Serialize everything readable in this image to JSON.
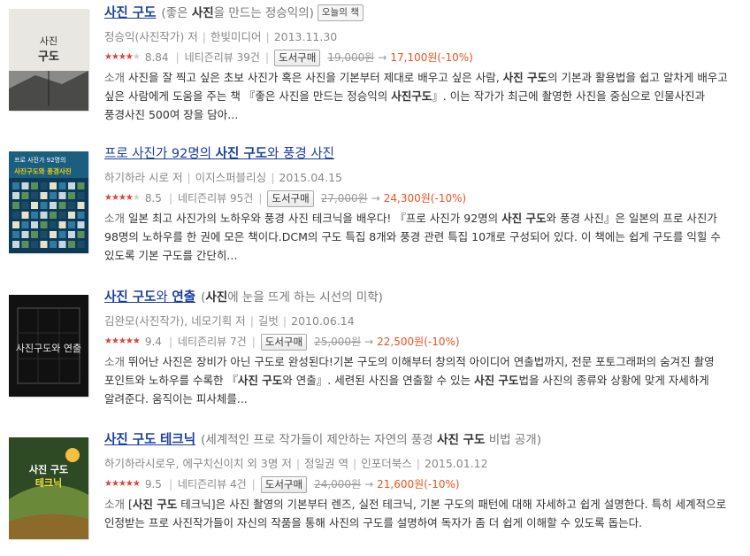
{
  "books": [
    {
      "title_parts": [
        {
          "text": "사진 구도",
          "bold": true
        }
      ],
      "subtitle_parts": [
        {
          "text": "(좋은 ",
          "bold": false
        },
        {
          "text": "사진",
          "bold": true
        },
        {
          "text": "을 만드는 정승익의)",
          "bold": false
        }
      ],
      "badge": "오늘의 책",
      "meta": [
        "정승익(사진작가) 저",
        "한빛미디어",
        "2013.11.30"
      ],
      "stars": 4,
      "score": "8.84",
      "review_count": "네티즌리뷰 39건",
      "buy_label": "도서구매",
      "original_price": "19,000원",
      "sale_price": "17,100원(-10%)",
      "desc_label": "소개",
      "desc_parts": [
        {
          "text": "사진을 잘 찍고 싶은 초보 사진가 혹은 사진을 기본부터 제대로 배우고 싶은 사람, ",
          "bold": false
        },
        {
          "text": "사진 구도",
          "bold": true
        },
        {
          "text": "의 기본과 활용법을 쉽고 알차게 배우고 싶은 사람에게 도움을 주는 책 『좋은 사진을 만드는 정승익의 ",
          "bold": false
        },
        {
          "text": "사진구도",
          "bold": true
        },
        {
          "text": "』. 이는 작가가 최근에 촬영한 사진을 중심으로 인물사진과 풍경사진 500여 장을 담아...",
          "bold": false
        }
      ],
      "cover": {
        "bg": "#e9e7e2",
        "text1": "사진",
        "text2": "구도",
        "accent": "#2c2c2c"
      }
    },
    {
      "title_parts": [
        {
          "text": "프로 사진가 92명의 ",
          "bold": false
        },
        {
          "text": "사진 구도",
          "bold": true
        },
        {
          "text": "와 풍경 사진",
          "bold": false
        }
      ],
      "subtitle_parts": [],
      "badge": "",
      "meta": [
        "하기하라 시로 저",
        "이지스퍼블리싱",
        "2015.04.15"
      ],
      "stars": 4,
      "score": "8.5",
      "review_count": "네티즌리뷰 95건",
      "buy_label": "도서구매",
      "original_price": "27,000원",
      "sale_price": "24,300원(-10%)",
      "desc_label": "소개",
      "desc_parts": [
        {
          "text": "일본 최고 사진가의 노하우와 풍경 사진 테크닉을 배우다! 『프로 사진가 92명의 ",
          "bold": false
        },
        {
          "text": "사진 구도",
          "bold": true
        },
        {
          "text": "와 풍경 사진』은 일본의 프로 사진가 98명의 노하우를 한 권에 모은 책이다.DCM의 구도 특집 8개와 풍경 관련 특집 10개로 구성되어 있다. 이 책에는 쉽게 구도를 익힐 수 있도록 기본 구도를 간단히...",
          "bold": false
        }
      ],
      "cover": {
        "bg": "#0d3b57",
        "text1": "프로 사진가 92명의",
        "text2": "사진구도와 풍경사진",
        "accent": "#f4d000"
      }
    },
    {
      "title_parts": [
        {
          "text": "사진 구도",
          "bold": true
        },
        {
          "text": "와 ",
          "bold": false
        },
        {
          "text": "연출",
          "bold": true
        }
      ],
      "subtitle_parts": [
        {
          "text": "(",
          "bold": false
        },
        {
          "text": "사진",
          "bold": true
        },
        {
          "text": "에 눈을 뜨게 하는 시선의 미학)",
          "bold": false
        }
      ],
      "badge": "",
      "meta": [
        "김완모(사진작가), 네모기획 저",
        "길벗",
        "2010.06.14"
      ],
      "stars": 5,
      "score": "9.4",
      "review_count": "네티즌리뷰 7건",
      "buy_label": "도서구매",
      "original_price": "25,000원",
      "sale_price": "22,500원(-10%)",
      "desc_label": "소개",
      "desc_parts": [
        {
          "text": "뛰어난 사진은 장비가 아닌 구도로 완성된다!기본 구도의 이해부터 창의적 아이디어 연출법까지, 전문 포토그래퍼의 숨겨진 촬영 포인트와 노하우를 수록한 『",
          "bold": false
        },
        {
          "text": "사진 구도",
          "bold": true
        },
        {
          "text": "와 연출』. 세련된 사진을 연출할 수 있는 ",
          "bold": false
        },
        {
          "text": "사진 구도",
          "bold": true
        },
        {
          "text": "법을 사진의 종류와 상황에 맞게 자세하게 알려준다. 움직이는 피사체를...",
          "bold": false
        }
      ],
      "cover": {
        "bg": "#111111",
        "text1": "사진구도와 연출",
        "text2": "",
        "accent": "#e8e8e8"
      }
    },
    {
      "title_parts": [
        {
          "text": "사진 구도",
          "bold": true
        },
        {
          "text": " ",
          "bold": false
        },
        {
          "text": "테크닉",
          "bold": true
        }
      ],
      "subtitle_parts": [
        {
          "text": "(세계적인 프로 작가들이 제안하는 자연의 풍경 ",
          "bold": false
        },
        {
          "text": "사진 구도",
          "bold": true
        },
        {
          "text": " 비법 공개)",
          "bold": false
        }
      ],
      "badge": "",
      "meta": [
        "하기하라시로우, 에구치신이치 외 3명 저",
        "정일권 역",
        "인포더북스",
        "2015.01.12"
      ],
      "stars": 5,
      "score": "9.5",
      "review_count": "네티즌리뷰 4건",
      "buy_label": "도서구매",
      "original_price": "24,000원",
      "sale_price": "21,600원(-10%)",
      "desc_label": "소개",
      "desc_parts": [
        {
          "text": "[",
          "bold": false
        },
        {
          "text": "사진 구도",
          "bold": true
        },
        {
          "text": " 테크닉]은 사진 촬영의 기본부터 렌즈, 실전 테크닉, 기본 구도의 패턴에 대해 자세하고 쉽게 설명한다. 특히 세계적으로 인정받는 프로 사진작가들이 자신의 작품을 통해 사진의 구도를 설명하여 독자가 좀 더 쉽게 이해할 수 있도록 돕는다.",
          "bold": false
        }
      ],
      "cover": {
        "bg": "#3a5a2a",
        "text1": "사진 구도",
        "text2": "테크닉",
        "accent": "#f0e040"
      }
    }
  ]
}
